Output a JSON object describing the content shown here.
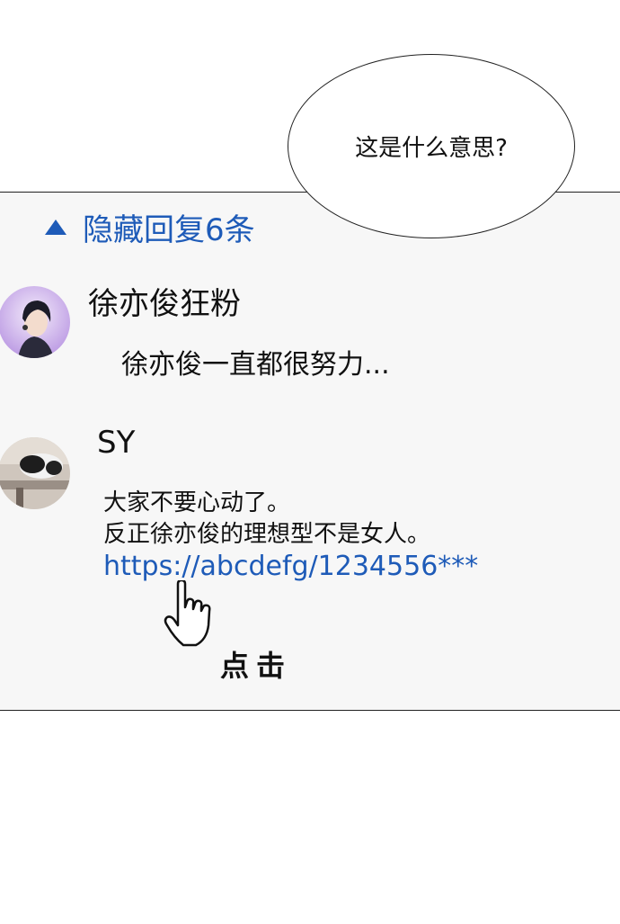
{
  "speech_bubble": {
    "text": "这是什么意思?"
  },
  "toggle": {
    "label": "隐藏回复6条",
    "icon": "triangle-up-icon",
    "color": "#1e5bb8"
  },
  "comments": [
    {
      "author": "徐亦俊狂粉",
      "avatar": "anime-boy-avatar",
      "lines": [
        "徐亦俊一直都很努力..."
      ]
    },
    {
      "author": "SY",
      "avatar": "cat-photo-avatar",
      "lines": [
        "大家不要心动了。",
        "反正徐亦俊的理想型不是女人。"
      ],
      "link": "https://abcdefg/1234556***"
    }
  ],
  "annotation": {
    "label": "点击",
    "icon": "hand-pointer-icon"
  }
}
